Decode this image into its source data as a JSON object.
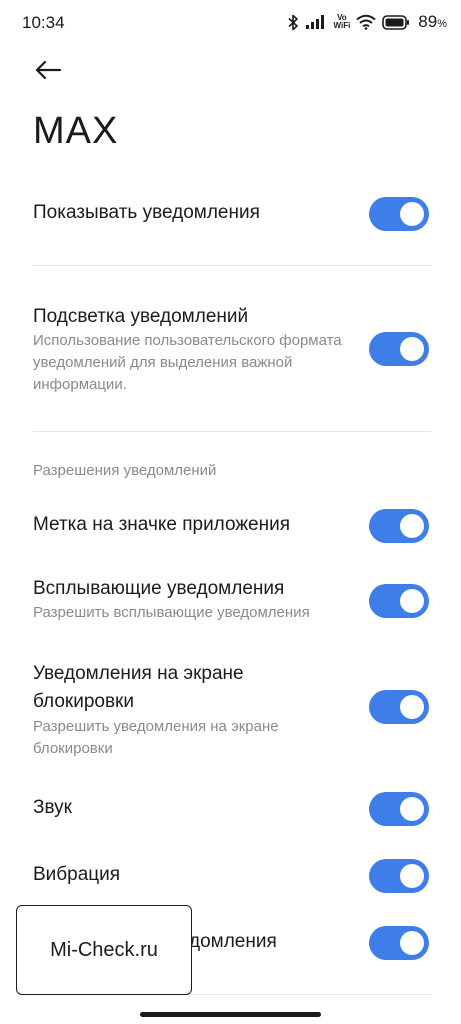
{
  "status_bar": {
    "time": "10:34",
    "volte_top": "Vo",
    "volte_bottom": "WiFi",
    "battery_value": "89",
    "battery_unit": "%",
    "icons": [
      "bluetooth-icon",
      "signal-icon",
      "vowifi-icon",
      "wifi-icon",
      "battery-icon"
    ]
  },
  "header": {
    "title": "MAX",
    "back_icon": "arrow-left-icon"
  },
  "settings": {
    "show_notifications": {
      "title": "Показывать уведомления",
      "enabled": true
    },
    "highlight": {
      "title": "Подсветка уведомлений",
      "subtitle": "Использование пользовательского формата уведомлений для выделения важной информации.",
      "enabled": true
    },
    "section_header": "Разрешения уведомлений",
    "badge": {
      "title": "Метка на значке приложения",
      "enabled": true
    },
    "popup": {
      "title": "Всплывающие уведомления",
      "subtitle": "Разрешить всплывающие уведомления",
      "enabled": true
    },
    "lockscreen": {
      "title": "Уведомления на экране блокировки",
      "subtitle": "Разрешить уведомления на экране блокировки",
      "enabled": true
    },
    "sound": {
      "title": "Звук",
      "enabled": true
    },
    "vibration": {
      "title": "Вибрация",
      "enabled": true
    },
    "partial": {
      "title_visible": "домления",
      "enabled": true
    }
  },
  "watermark": {
    "text": "Mi-Check.ru"
  },
  "colors": {
    "accent": "#3f7ee8",
    "text": "#1b1b1b",
    "secondary": "#8a8a8a",
    "divider": "#e6e6e6"
  }
}
